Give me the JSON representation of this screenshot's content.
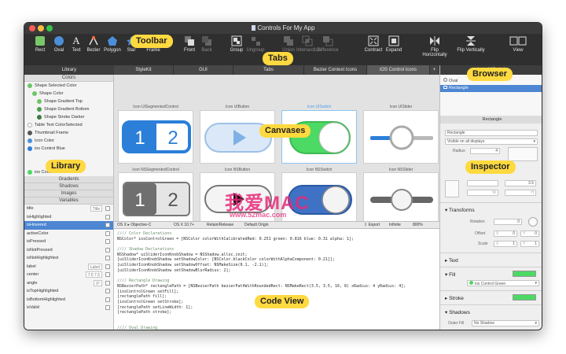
{
  "window": {
    "title": "Controls For My App"
  },
  "toolbar": {
    "tools": [
      {
        "label": "Rect",
        "icon": "rect-icon"
      },
      {
        "label": "Oval",
        "icon": "oval-icon"
      },
      {
        "label": "Text",
        "icon": "text-icon"
      },
      {
        "label": "Bezier",
        "icon": "bezier-icon"
      },
      {
        "label": "Polygon",
        "icon": "polygon-icon"
      },
      {
        "label": "Star",
        "icon": "star-icon"
      },
      {
        "label": "Frame",
        "icon": "frame-icon"
      },
      {
        "label": "Front",
        "icon": "front-icon"
      },
      {
        "label": "Back",
        "icon": "back-icon"
      },
      {
        "label": "Group",
        "icon": "group-icon"
      },
      {
        "label": "Ungroup",
        "icon": "ungroup-icon"
      },
      {
        "label": "Union",
        "icon": "union-icon"
      },
      {
        "label": "Intersection",
        "icon": "intersection-icon"
      },
      {
        "label": "Difference",
        "icon": "difference-icon"
      },
      {
        "label": "Contract",
        "icon": "contract-icon"
      },
      {
        "label": "Expand",
        "icon": "expand-icon"
      },
      {
        "label": "Flip Horizontally",
        "icon": "flip-horizontal-icon"
      },
      {
        "label": "Flip Vertically",
        "icon": "flip-vertical-icon"
      },
      {
        "label": "View",
        "icon": "view-icon"
      }
    ]
  },
  "library": {
    "header": "Library",
    "sections": {
      "colors": "Colors",
      "gradients": "Gradients",
      "shadows": "Shadows",
      "images": "Images",
      "variables": "Variables"
    },
    "color_items": [
      {
        "label": "Shape Selected Color",
        "color": "#6fc46a"
      },
      {
        "label": "Shape Color",
        "color": "#6fc46a"
      },
      {
        "label": "Shape Gradient Top",
        "color": "#6fc46a"
      },
      {
        "label": "Shape Gradient Bottom",
        "color": "#4a9e4a"
      },
      {
        "label": "Shape Stroke Darker",
        "color": "#3d7a3d"
      },
      {
        "label": "Table Text ColorSelected",
        "color": "#ffffff"
      },
      {
        "label": "Thumbnail Frame",
        "color": "#555555"
      },
      {
        "label": "Icon Color",
        "color": "#4a8fd8"
      },
      {
        "label": "ios Control Blue",
        "color": "#2b7fd8"
      },
      {
        "label": "ios Control Green",
        "color": "#4cd964"
      }
    ],
    "variables": [
      {
        "label": "title",
        "value": "Title"
      },
      {
        "label": "isHighlighted",
        "value": ""
      },
      {
        "label": "isHovered",
        "value": ""
      },
      {
        "label": "activeColor",
        "value": ""
      },
      {
        "label": "isPressed",
        "value": ""
      },
      {
        "label": "isNotPressed",
        "value": ""
      },
      {
        "label": "isNotHighlighted",
        "value": ""
      },
      {
        "label": "label",
        "value": "Label"
      },
      {
        "label": "center",
        "value": "7.5   7.5"
      },
      {
        "label": "angle",
        "value": "0°"
      },
      {
        "label": "isTopHighlighted",
        "value": ""
      },
      {
        "label": "isBottomHighlighted",
        "value": ""
      },
      {
        "label": "isValid",
        "value": ""
      }
    ]
  },
  "tabs": {
    "items": [
      "StyleKit",
      "GUI",
      "Tabs",
      "Bezier Context Icons",
      "iOS Control Icons"
    ],
    "active_index": 4,
    "add_label": "+",
    "right_label": "Icon UISwitch"
  },
  "canvases": [
    {
      "label": "Icon UISegmentedControl",
      "seg1": "1",
      "seg2": "2"
    },
    {
      "label": "Icon UIButton"
    },
    {
      "label": "Icon UISwitch"
    },
    {
      "label": "Icon UISlider"
    },
    {
      "label": "Icon NSSegmentedControl",
      "seg1": "1",
      "seg2": "2"
    },
    {
      "label": "Icon NSButton"
    },
    {
      "label": "Icon NSSwitch"
    },
    {
      "label": "Icon NSSlider"
    }
  ],
  "codebar": {
    "items": [
      "OS X ▸ Objective-C",
      "OS X 10.7+",
      "Retain/Release",
      "Default Origin"
    ],
    "export": "Export",
    "infinite": "Infinite",
    "zoom": "800%"
  },
  "code_lines": [
    {
      "t": "//// Color Declarations",
      "k": "cm"
    },
    {
      "t": "NSColor* iosControlGreen = [NSColor colorWithCalibratedRed: 0.251 green: 0.816 blue: 0.31 alpha: 1];",
      "k": ""
    },
    {
      "t": "",
      "k": ""
    },
    {
      "t": "//// Shadow Declarations",
      "k": "cm"
    },
    {
      "t": "NSShadow* uiSliderIconKnobShadow = NSShadow.alloc.init;",
      "k": ""
    },
    {
      "t": "[uiSliderIconKnobShadow setShadowColor: [NSColor.blackColor colorWithAlphaComponent: 0.21]];",
      "k": ""
    },
    {
      "t": "[uiSliderIconKnobShadow setShadowOffset: NSMakeSize(0.1, -2.1)];",
      "k": ""
    },
    {
      "t": "[uiSliderIconKnobShadow setShadowBlurRadius: 2];",
      "k": ""
    },
    {
      "t": "",
      "k": ""
    },
    {
      "t": "//// Rectangle Drawing",
      "k": "cm"
    },
    {
      "t": "NSBezierPath* rectanglePath = [NSBezierPath bezierPathWithRoundedRect: NSMakeRect(3.5, 3.5, 16, 8) xRadius: 4 yRadius: 4];",
      "k": ""
    },
    {
      "t": "[iosControlGreen setFill];",
      "k": ""
    },
    {
      "t": "[rectanglePath fill];",
      "k": ""
    },
    {
      "t": "[iosControlGreen setStroke];",
      "k": ""
    },
    {
      "t": "[rectanglePath setLineWidth: 1];",
      "k": ""
    },
    {
      "t": "[rectanglePath stroke];",
      "k": ""
    },
    {
      "t": "",
      "k": ""
    },
    {
      "t": "",
      "k": ""
    },
    {
      "t": "//// Oval Drawing",
      "k": "cm"
    },
    {
      "t": "NSBezierPath* ovalPath = [NSBezierPath bezierPathWithOvalInRect: NSMakeRect(11.5, 3.5, 8, 8)];",
      "k": ""
    }
  ],
  "inspector": {
    "browser_header": "Icon UISwitch",
    "browser_items": [
      "Oval",
      "Rectangle"
    ],
    "panel_title": "Rectangle",
    "name_value": "Rectangle",
    "visibility": "Visible on all displays",
    "radius_label": "Radius",
    "radius_value": "4",
    "pos_x": "3.5",
    "w_label": "W",
    "h_label": "H",
    "transforms": "Transforms",
    "rotation": "Rotation",
    "rotation_value": "0",
    "offset": "Offset",
    "offset_x": "0",
    "offset_y": "0",
    "scale": "Scale",
    "scale_x": "1",
    "scale_y": "1",
    "x_label": "X",
    "y_label": "Y",
    "text": "Text",
    "fill": "Fill",
    "fill_value": "ios Control Green",
    "stroke": "Stroke",
    "shadows": "Shadows",
    "outer_fill": "Outer Fill",
    "no_shadow": "No Shadow"
  },
  "callouts": {
    "toolbar": "Toolbar",
    "tabs": "Tabs",
    "browser": "Browser",
    "canvases": "Canvases",
    "library": "Library",
    "inspector": "Inspector",
    "code_view": "Code View"
  },
  "watermark": {
    "title": "我爱MAC",
    "url": "www.52mac.com"
  },
  "colors": {
    "ios_blue": "#2b7fd8",
    "ios_green": "#4cd964",
    "callout": "#ffd940",
    "selection": "#4d86d2"
  }
}
